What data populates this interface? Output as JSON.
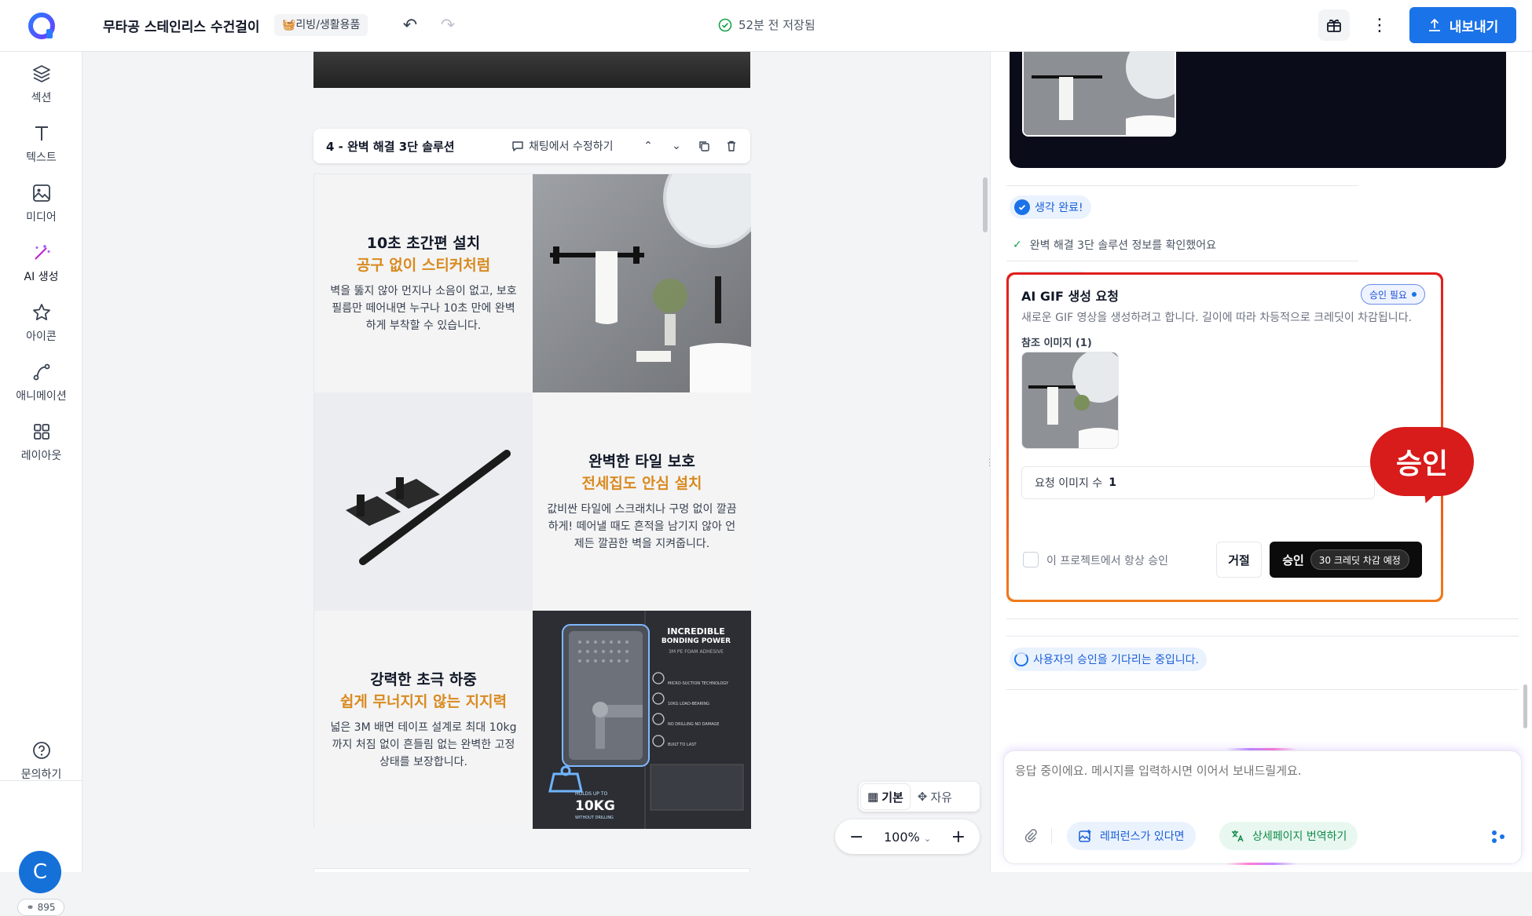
{
  "header": {
    "title": "무타공 스테인리스 수건걸이",
    "category": "🧺리빙/생활용품",
    "save_status": "52분 전 저장됨",
    "export_label": "내보내기"
  },
  "sidebar": {
    "items": [
      {
        "label": "섹션",
        "icon": "layers-icon"
      },
      {
        "label": "텍스트",
        "icon": "text-icon"
      },
      {
        "label": "미디어",
        "icon": "image-icon"
      },
      {
        "label": "AI 생성",
        "icon": "magic-wand-icon"
      },
      {
        "label": "아이콘",
        "icon": "star-icon"
      },
      {
        "label": "애니메이션",
        "icon": "motion-path-icon"
      },
      {
        "label": "레이아웃",
        "icon": "grid-icon"
      }
    ],
    "help_label": "문의하기",
    "avatar_initial": "C",
    "credits": "895"
  },
  "canvas": {
    "section_title": "4 - 완벽 해결 3단 솔루션",
    "chat_edit_label": "채팅에서 수정하기",
    "blocks": [
      {
        "heading": "10초 초간편 설치",
        "subheading": "공구 없이 스티커처럼",
        "body": "벽을 뚫지 않아 먼지나 소음이 없고, 보호 필름만 떼어내면 누구나 10초 만에 완벽하게 부착할 수 있습니다."
      },
      {
        "heading": "완벽한 타일 보호",
        "subheading": "전세집도 안심 설치",
        "body": "값비싼 타일에 스크래치나 구멍 없이 깔끔하게! 떼어낼 때도 흔적을 남기지 않아 언제든 깔끔한 벽을 지켜줍니다."
      },
      {
        "heading": "강력한 초극 하중",
        "subheading": "쉽게 무너지지 않는 지지력",
        "body": "넓은 3M 배면 테이프 설계로 최대 10kg까지 처짐 없이 흔들림 없는 완벽한 고정 상태를 보장합니다."
      }
    ],
    "poster": {
      "title1": "INCREDIBLE",
      "title2": "BONDING POWER",
      "subtitle": "3M PE FOAM ADHESIVE",
      "features": [
        "MICRO-SUCTION TECHNOLOGY",
        "10KG LOAD-BEARING",
        "NO DRILLING NO DAMAGE",
        "BUILT TO LAST"
      ],
      "holds_label": "HOLDS UP TO",
      "weight": "10KG",
      "weight_sub": "WITHOUT DRILLING"
    },
    "mode_basic": "기본",
    "mode_free": "자유",
    "zoom": "100%"
  },
  "panel": {
    "thinking_done": "생각 완료!",
    "info_line": "완벽 해결 3단 솔루션 정보를 확인했어요",
    "request": {
      "title": "AI GIF 생성 요청",
      "badge": "승인 필요",
      "description": "새로운 GIF 영상을 생성하려고 합니다. 길이에 따라 차등적으로 크레딧이 차감됩니다.",
      "ref_label": "참조 이미지 (1)",
      "count_label": "요청 이미지 수",
      "count_value": "1",
      "always_approve": "이 프로젝트에서 항상 승인",
      "reject": "거절",
      "approve": "승인",
      "credit_note": "30 크레딧 차감 예정",
      "callout": "승인"
    },
    "waiting": "사용자의 승인을 기다리는 중입니다.",
    "input_placeholder": "응답 중이에요. 메시지를 입력하시면 이어서 보내드릴게요.",
    "reference_pill": "레퍼런스가 있다면",
    "translate_pill": "상세페이지 번역하기"
  },
  "colors": {
    "accent": "#1a73e8",
    "orange_text": "#d98a1f",
    "callout_red": "#d81b1b"
  }
}
